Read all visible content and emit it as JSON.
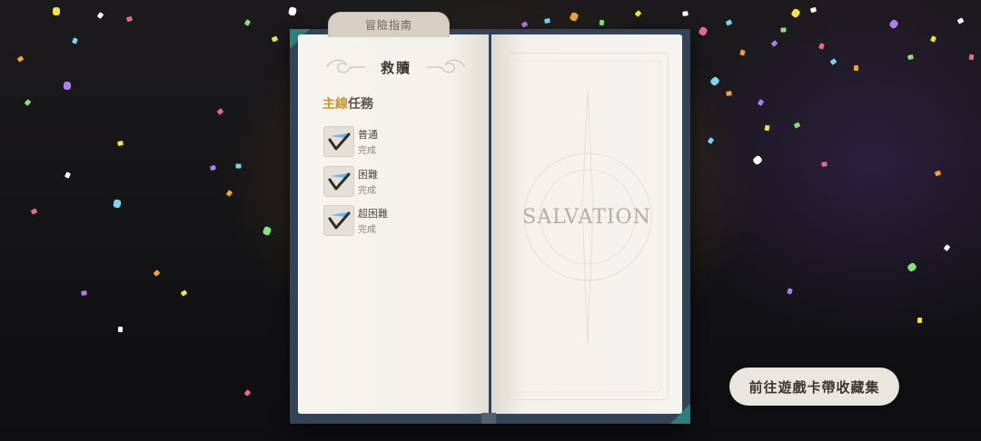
{
  "tab": {
    "label": "冒險指南"
  },
  "left_page": {
    "title": "救贖",
    "section": {
      "accent": "主線",
      "rest": "任務"
    },
    "quests": [
      {
        "name": "普通",
        "status": "完成"
      },
      {
        "name": "困難",
        "status": "完成"
      },
      {
        "name": "超困難",
        "status": "完成"
      }
    ]
  },
  "right_page": {
    "card_title": "SALVATION"
  },
  "button": {
    "label": "前往遊戲卡帶收藏集"
  },
  "colors": {
    "accent_gold": "#c7942e",
    "check_blue": "#3a8fd8",
    "cover_blue": "#33435a",
    "page": "#f4f2ec"
  }
}
